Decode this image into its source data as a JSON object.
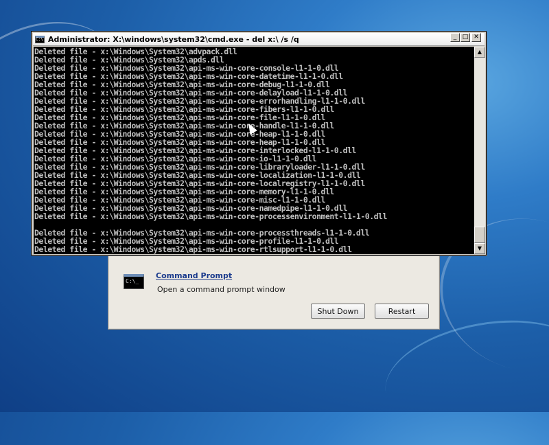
{
  "recovery": {
    "option_icon_text": "C:\\_",
    "option_title": "Command Prompt",
    "option_description": "Open a command prompt window",
    "shutdown_label": "Shut Down",
    "restart_label": "Restart"
  },
  "cmd": {
    "title": "Administrator: X:\\windows\\system32\\cmd.exe - del x:\\ /s /q",
    "icon_text": "C:\\",
    "minimize_glyph": "_",
    "maximize_glyph": "□",
    "close_glyph": "✕",
    "scroll_up_glyph": "▲",
    "scroll_down_glyph": "▼",
    "lines": [
      "Deleted file - x:\\Windows\\System32\\advpack.dll",
      "Deleted file - x:\\Windows\\System32\\apds.dll",
      "Deleted file - x:\\Windows\\System32\\api-ms-win-core-console-l1-1-0.dll",
      "Deleted file - x:\\Windows\\System32\\api-ms-win-core-datetime-l1-1-0.dll",
      "Deleted file - x:\\Windows\\System32\\api-ms-win-core-debug-l1-1-0.dll",
      "Deleted file - x:\\Windows\\System32\\api-ms-win-core-delayload-l1-1-0.dll",
      "Deleted file - x:\\Windows\\System32\\api-ms-win-core-errorhandling-l1-1-0.dll",
      "Deleted file - x:\\Windows\\System32\\api-ms-win-core-fibers-l1-1-0.dll",
      "Deleted file - x:\\Windows\\System32\\api-ms-win-core-file-l1-1-0.dll",
      "Deleted file - x:\\Windows\\System32\\api-ms-win-core-handle-l1-1-0.dll",
      "Deleted file - x:\\Windows\\System32\\api-ms-win-core-heap-l1-1-0.dll",
      "Deleted file - x:\\Windows\\System32\\api-ms-win-core-heap-l1-1-0.dll",
      "Deleted file - x:\\Windows\\System32\\api-ms-win-core-interlocked-l1-1-0.dll",
      "Deleted file - x:\\Windows\\System32\\api-ms-win-core-io-l1-1-0.dll",
      "Deleted file - x:\\Windows\\System32\\api-ms-win-core-libraryloader-l1-1-0.dll",
      "Deleted file - x:\\Windows\\System32\\api-ms-win-core-localization-l1-1-0.dll",
      "Deleted file - x:\\Windows\\System32\\api-ms-win-core-localregistry-l1-1-0.dll",
      "Deleted file - x:\\Windows\\System32\\api-ms-win-core-memory-l1-1-0.dll",
      "Deleted file - x:\\Windows\\System32\\api-ms-win-core-misc-l1-1-0.dll",
      "Deleted file - x:\\Windows\\System32\\api-ms-win-core-namedpipe-l1-1-0.dll",
      "Deleted file - x:\\Windows\\System32\\api-ms-win-core-processenvironment-l1-1-0.dll",
      "",
      "Deleted file - x:\\Windows\\System32\\api-ms-win-core-processthreads-l1-1-0.dll",
      "Deleted file - x:\\Windows\\System32\\api-ms-win-core-profile-l1-1-0.dll",
      "Deleted file - x:\\Windows\\System32\\api-ms-win-core-rtlsupport-l1-1-0.dll"
    ]
  }
}
